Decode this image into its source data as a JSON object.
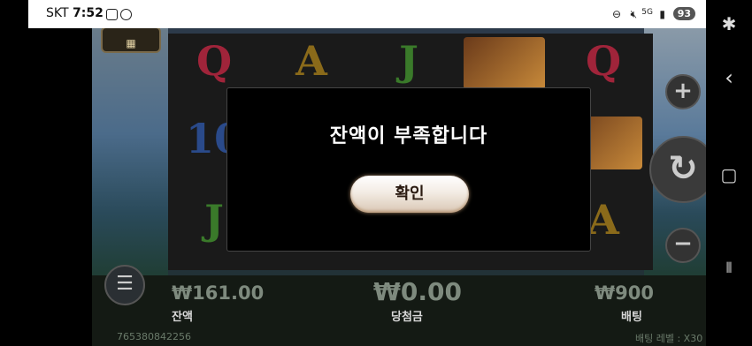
{
  "status_bar": {
    "carrier": "SKT",
    "time": "7:52",
    "battery": "93"
  },
  "game": {
    "reels": [
      [
        "Q",
        "10",
        "J"
      ],
      [
        "A",
        "",
        ""
      ],
      [
        "J",
        "",
        ""
      ],
      [
        "",
        "",
        ""
      ],
      [
        "Q",
        "",
        "A"
      ]
    ],
    "balance_value": "₩161.00",
    "balance_label": "잔액",
    "win_value": "₩0.00",
    "win_label": "당첨금",
    "bet_value": "₩900",
    "bet_label": "배팅",
    "round_id": "765380842256",
    "bet_level_label": "배팅 레벨 : X30"
  },
  "dialog": {
    "message": "잔액이 부족합니다",
    "confirm_label": "확인"
  },
  "colors": {
    "dialog_bg": "#000000",
    "button_bg": "#f3ece4",
    "status_bar_bg": "#ffffff"
  },
  "icons": {
    "status": [
      "screenshot-icon",
      "chat-icon",
      "dnd-icon",
      "mute-icon",
      "5g-icon",
      "signal-icon"
    ],
    "navigation": [
      "accessibility-icon",
      "back-icon",
      "home-icon",
      "recents-icon"
    ]
  }
}
